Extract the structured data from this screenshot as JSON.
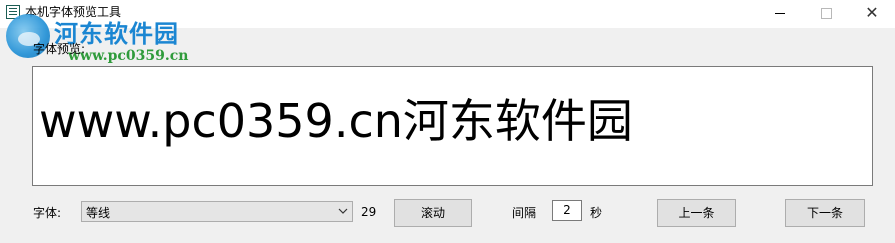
{
  "window": {
    "title": "本机字体预览工具",
    "controls": {
      "minimize": "minimize",
      "maximize": "maximize",
      "close": "✕"
    }
  },
  "watermark": {
    "name": "河东软件园",
    "url": "www.pc0359.cn"
  },
  "preview": {
    "label": "字体预览:",
    "text": "www.pc0359.cn河东软件园"
  },
  "controls": {
    "font_label": "字体:",
    "font_selected": "等线",
    "font_size": "29",
    "scroll_button": "滚动",
    "interval_label": "间隔",
    "interval_value": "2",
    "seconds_label": "秒",
    "prev_button": "上一条",
    "next_button": "下一条"
  },
  "icons": {
    "app": "app-icon",
    "dropdown": "chevron-down-icon"
  },
  "colors": {
    "watermark_name": "#1b86d2",
    "watermark_url": "#2f9b3b",
    "window_bg": "#f0f0f0"
  }
}
